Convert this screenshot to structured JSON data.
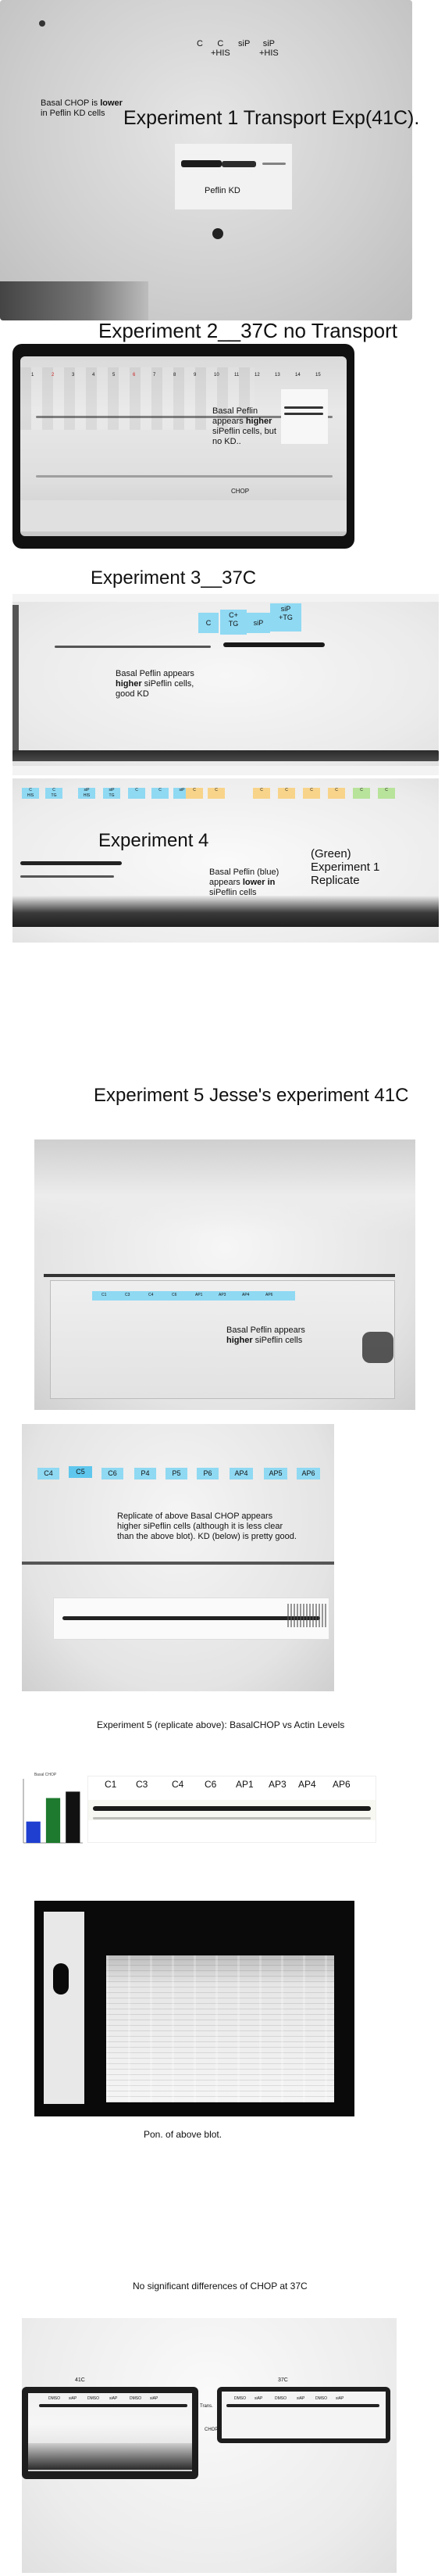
{
  "exp1": {
    "title": "Experiment 1 Transport Exp(41C).",
    "lanes": [
      "C",
      "C\n+HIS",
      "siP",
      "siP\n+HIS"
    ],
    "note_pre": "Basal CHOP is ",
    "note_bold": "lower",
    "note_post": " in Peflin KD cells",
    "label": "Peflin KD"
  },
  "exp2": {
    "title": "Experiment 2__37C no Transport",
    "lanes": [
      "1",
      "2",
      "3",
      "4",
      "5",
      "6",
      "7",
      "8",
      "9",
      "10",
      "11",
      "12",
      "13",
      "14",
      "15"
    ],
    "note_pre": "Basal Peflin appears ",
    "note_bold": "higher",
    "note_post": " siPeflin cells, but no KD..",
    "chop": "CHOP"
  },
  "exp3": {
    "title": "Experiment 3__37C",
    "tags": [
      "C",
      "C+\nTG",
      "siP",
      "siP\n+TG"
    ],
    "note_pre": "Basal Peflin appears ",
    "note_bold": "higher",
    "note_post": " siPeflin cells, good KD"
  },
  "exp4": {
    "title": "Experiment 4",
    "note_pre": "Basal Peflin (blue) appears ",
    "note_bold": "lower in",
    "note_post": " siPeflin cells",
    "green_note": "(Green)\nExperiment 1\nReplicate",
    "blue_tags": [
      "C\nHIS",
      "C\nTG",
      "siP\nHIS",
      "siP\nTG",
      "C",
      "C",
      "siP"
    ],
    "yellow_tags": [
      "C",
      "C"
    ],
    "yellow_tags2": [
      "C",
      "C",
      "C",
      "C"
    ],
    "green_tags": [
      "C",
      "C"
    ]
  },
  "exp5": {
    "title": "Experiment 5 Jesse's experiment 41C",
    "note_pre": "Basal Peflin appears ",
    "note_bold": "higher",
    "note_post": " siPeflin cells",
    "strip_labels": [
      "C1",
      "C3",
      "C4",
      "C6",
      "AP1",
      "AP3",
      "AP4",
      "AP6"
    ],
    "tags": [
      "C4",
      "C5",
      "C6",
      "P4",
      "P5",
      "P6",
      "AP4",
      "AP5",
      "AP6"
    ],
    "replicate_note": "Replicate of above Basal CHOP appears higher siPeflin cells (although it is less clear than the above blot). KD (below) is pretty good."
  },
  "exp5rep": {
    "title": "Experiment 5 (replicate above): BasalCHOP vs Actin Levels",
    "lanes": [
      "C1",
      "C3",
      "C4",
      "C6",
      "AP1",
      "AP3",
      "AP4",
      "AP6"
    ],
    "chart_title": "Basal CHOP",
    "chart_data": {
      "type": "bar",
      "categories": [
        "",
        "",
        ""
      ],
      "values": [
        0.5,
        1.05,
        1.2
      ],
      "colors": [
        "#1f3fd1",
        "#1e7a2e",
        "#111111"
      ],
      "ylim": [
        0,
        1.5
      ]
    }
  },
  "ponceau": {
    "caption": "Pon. of above blot."
  },
  "final": {
    "caption": "No significant differences of CHOP at 37C",
    "left_label": "41C",
    "right_label": "37C",
    "mid_labels": [
      "Trans.",
      "CHOP"
    ],
    "lane_small": [
      "DMSO",
      "siAP",
      "DMSO",
      "siAP",
      "DMSO",
      "siAP"
    ]
  }
}
